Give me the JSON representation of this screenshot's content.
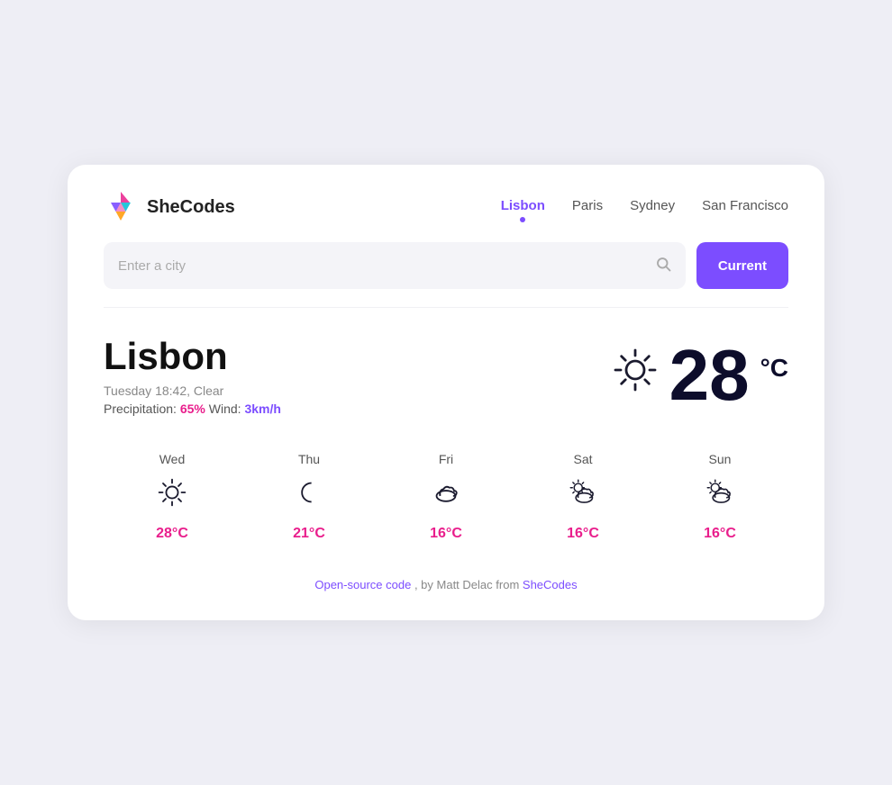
{
  "app": {
    "name": "SheCodes"
  },
  "nav": {
    "items": [
      {
        "label": "Lisbon",
        "active": true
      },
      {
        "label": "Paris",
        "active": false
      },
      {
        "label": "Sydney",
        "active": false
      },
      {
        "label": "San Francisco",
        "active": false
      }
    ]
  },
  "search": {
    "placeholder": "Enter a city",
    "button_label": "Current"
  },
  "weather": {
    "city": "Lisbon",
    "datetime": "Tuesday 18:42, Clear",
    "precipitation_label": "Precipitation:",
    "precipitation_value": "65%",
    "wind_label": "Wind:",
    "wind_value": "3km/h",
    "temperature": "28",
    "unit": "°C"
  },
  "forecast": [
    {
      "day": "Wed",
      "icon": "☀",
      "temp": "28°C"
    },
    {
      "day": "Thu",
      "icon": "🌙",
      "temp": "21°C"
    },
    {
      "day": "Fri",
      "icon": "🌥",
      "temp": "16°C"
    },
    {
      "day": "Sat",
      "icon": "🌤",
      "temp": "16°C"
    },
    {
      "day": "Sun",
      "icon": "🌤",
      "temp": "16°C"
    }
  ],
  "footer": {
    "text_before": "Open-source code",
    "text_middle": ", by ",
    "author": "Matt Delac",
    "text_after": " from ",
    "brand": "SheCodes"
  }
}
